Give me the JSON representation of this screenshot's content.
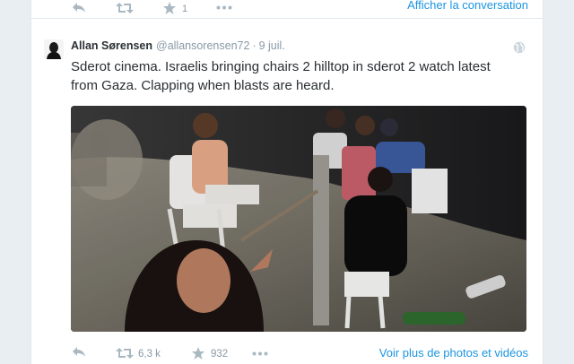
{
  "previous_tweet": {
    "favorite_count": "1",
    "show_conversation_label": "Afficher la conversation"
  },
  "tweet": {
    "fullname": "Allan Sørensen",
    "username": "@allansorensen72",
    "separator": "·",
    "timestamp": "9 juil.",
    "text": "Sderot cinema. Israelis bringing chairs 2 hilltop in sderot 2 watch latest from Gaza. Clapping when blasts are heard.",
    "retweet_count": "6,3 k",
    "favorite_count": "932",
    "more_photos_label": "Voir plus de photos et vidéos"
  },
  "icons": {
    "reply": "reply-icon",
    "retweet": "retweet-icon",
    "favorite": "star-icon",
    "more": "more-dots-icon",
    "globe": "globe-icon"
  },
  "colors": {
    "link": "#1b95e0",
    "meta": "#8899a6",
    "action_icon": "#aab8c2",
    "text": "#292f33"
  }
}
